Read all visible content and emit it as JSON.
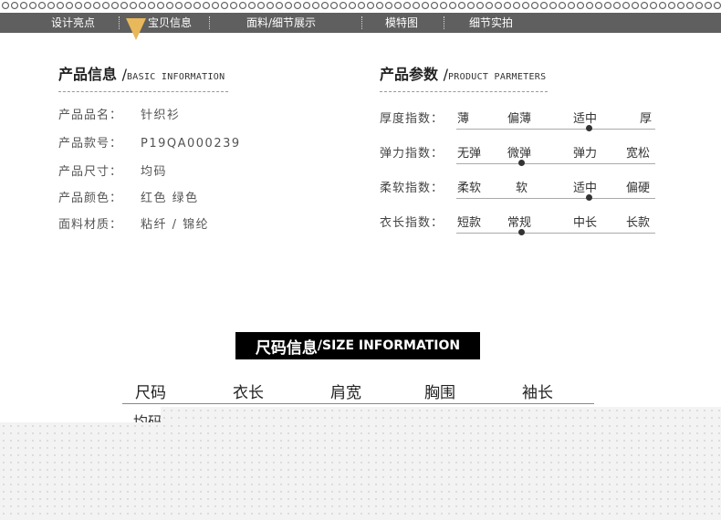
{
  "nav": {
    "items": [
      {
        "label": "设计亮点"
      },
      {
        "label": "宝贝信息"
      },
      {
        "label": "面料/细节展示"
      },
      {
        "label": "模特图"
      },
      {
        "label": "细节实拍"
      }
    ],
    "active_index": 1,
    "accent_color": "#e9b85a",
    "bar_color": "#5f5f5f"
  },
  "basic_info": {
    "title_cn": "产品信息",
    "title_sep": "/",
    "title_en": "BASIC INFORMATION",
    "rows": [
      {
        "key": "产品品名：",
        "value": "针织衫"
      },
      {
        "key": "产品款号：",
        "value": "P19QA000239"
      },
      {
        "key": "产品尺寸：",
        "value": "均码"
      },
      {
        "key": "产品颜色：",
        "value": "红色 绿色"
      },
      {
        "key": "面料材质：",
        "value": "粘纤 / 锦纶"
      }
    ]
  },
  "product_params": {
    "title_cn": "产品参数",
    "title_sep": "/",
    "title_en": "PRODUCT PARMETERS",
    "rows": [
      {
        "name": "厚度指数：",
        "options": [
          "薄",
          "偏薄",
          "适中",
          "厚"
        ],
        "selected": 2
      },
      {
        "name": "弹力指数：",
        "options": [
          "无弹",
          "微弹",
          "弹力",
          "宽松"
        ],
        "selected": 1
      },
      {
        "name": "柔软指数：",
        "options": [
          "柔软",
          "软",
          "适中",
          "偏硬"
        ],
        "selected": 2
      },
      {
        "name": "衣长指数：",
        "options": [
          "短款",
          "常规",
          "中长",
          "长款"
        ],
        "selected": 1
      }
    ]
  },
  "size_info": {
    "title_cn": "尺码信息",
    "title_sep": "/",
    "title_en": "SIZE INFORMATION",
    "headers": [
      "尺码",
      "衣长",
      "肩宽",
      "胸围",
      "袖长"
    ],
    "partial_row_text": "均码"
  }
}
